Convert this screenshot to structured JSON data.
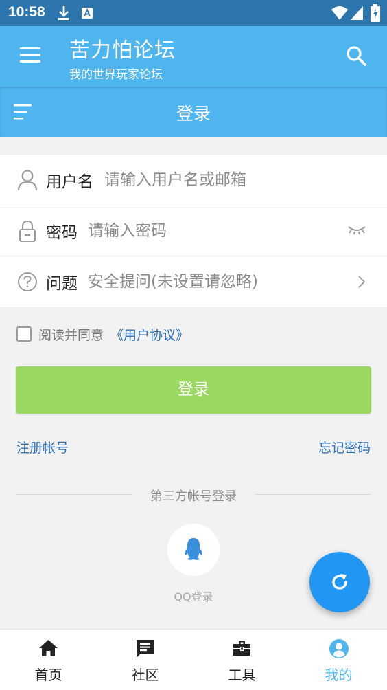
{
  "status_bar": {
    "time": "10:58"
  },
  "header": {
    "title": "苦力怕论坛",
    "subtitle": "我的世界玩家论坛"
  },
  "login_bar": {
    "title": "登录"
  },
  "form": {
    "username": {
      "label": "用户名",
      "placeholder": "请输入用户名或邮箱"
    },
    "password": {
      "label": "密码",
      "placeholder": "请输入密码"
    },
    "question": {
      "label": "问题",
      "placeholder": "安全提问(未设置请忽略)"
    }
  },
  "agreement": {
    "text": "阅读并同意",
    "link": "《用户协议》"
  },
  "login_button": "登录",
  "register_link": "注册帐号",
  "forgot_link": "忘记密码",
  "third_party": {
    "divider_text": "第三方帐号登录",
    "qq_label": "QQ登录"
  },
  "bottom_nav": [
    {
      "label": "首页",
      "icon": "home-icon",
      "active": false
    },
    {
      "label": "社区",
      "icon": "chat-icon",
      "active": false
    },
    {
      "label": "工具",
      "icon": "toolbox-icon",
      "active": false
    },
    {
      "label": "我的",
      "icon": "profile-icon",
      "active": true
    }
  ],
  "colors": {
    "status_bar": "#2d76ad",
    "header": "#4fb5ee",
    "login_button": "#9ad861",
    "link": "#2d6fb5",
    "fab": "#2196f3",
    "nav_active": "#4fb5ee"
  }
}
